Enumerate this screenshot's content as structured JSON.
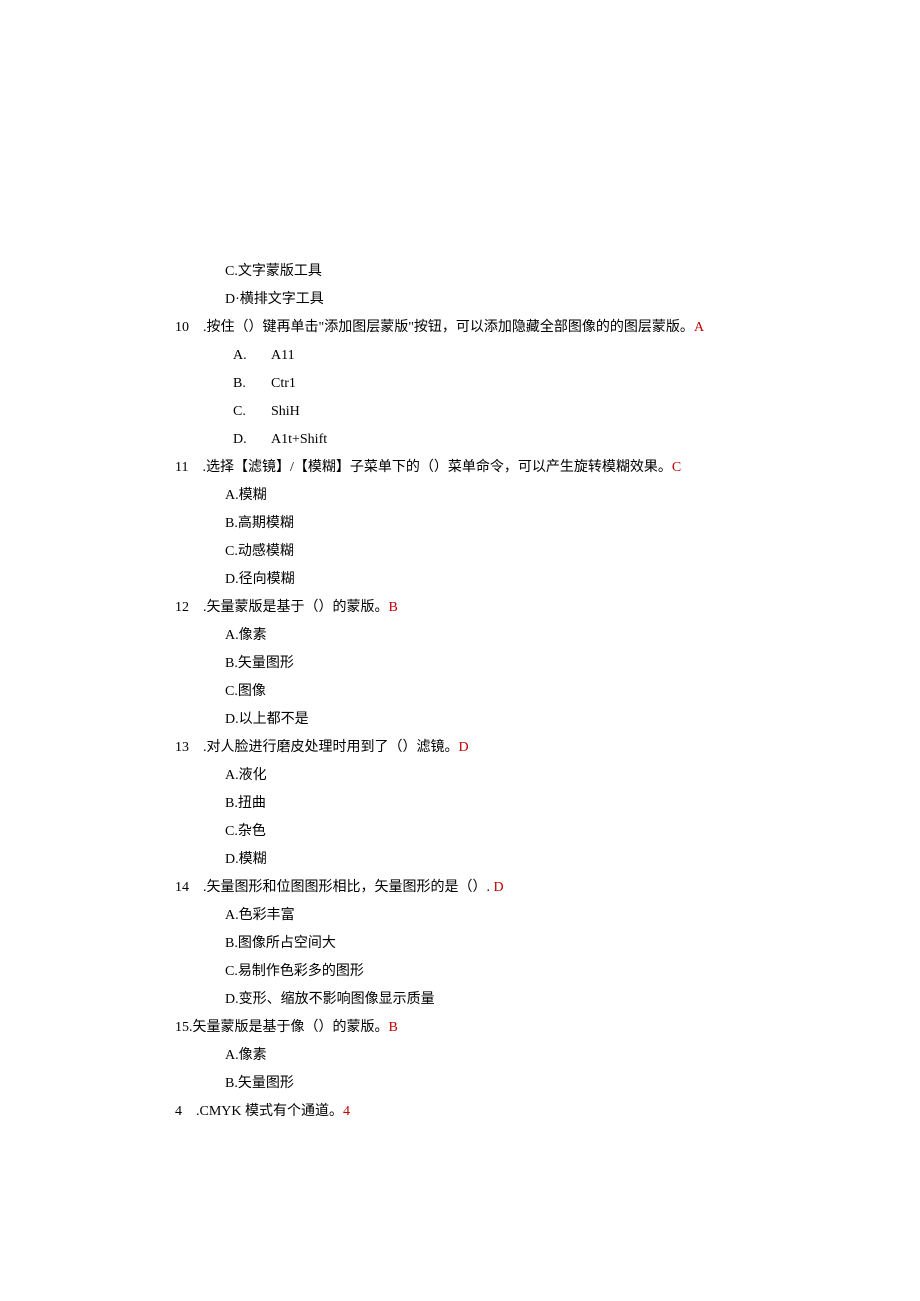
{
  "lines": [
    {
      "cls": "indent-2",
      "segments": [
        {
          "text": "C.文字蒙版工具"
        }
      ]
    },
    {
      "cls": "indent-2",
      "segments": [
        {
          "text": "D·横排文字工具"
        }
      ]
    },
    {
      "cls": "q-line",
      "segments": [
        {
          "text": "10　.按住（）键再单击\"添加图层蒙版\"按钮，可以添加隐藏全部图像的的图层蒙版。"
        },
        {
          "text": "A",
          "ans": true
        }
      ]
    },
    {
      "cls": "indent-3",
      "segments": [
        {
          "text": "A.",
          "letterWide": true
        },
        {
          "text": "A11"
        }
      ]
    },
    {
      "cls": "indent-3",
      "segments": [
        {
          "text": "B.",
          "letterWide": true
        },
        {
          "text": "Ctr1"
        }
      ]
    },
    {
      "cls": "indent-3",
      "segments": [
        {
          "text": "C.",
          "letterWide": true
        },
        {
          "text": "ShiH"
        }
      ]
    },
    {
      "cls": "indent-3",
      "segments": [
        {
          "text": "D.",
          "letterWide": true
        },
        {
          "text": "A1t+Shift"
        }
      ]
    },
    {
      "cls": "q-line",
      "segments": [
        {
          "text": "11　.选择【滤镜】/【模糊】子菜单下的（）菜单命令，可以产生旋转模糊效果。"
        },
        {
          "text": "C",
          "ans": true
        }
      ]
    },
    {
      "cls": "indent-2",
      "segments": [
        {
          "text": "A.模糊"
        }
      ]
    },
    {
      "cls": "indent-2",
      "segments": [
        {
          "text": "B.高期模糊"
        }
      ]
    },
    {
      "cls": "indent-2",
      "segments": [
        {
          "text": "C.动感模糊"
        }
      ]
    },
    {
      "cls": "indent-2",
      "segments": [
        {
          "text": "D.径向模糊"
        }
      ]
    },
    {
      "cls": "q-line",
      "segments": [
        {
          "text": "12　.矢量蒙版是基于（）的蒙版。"
        },
        {
          "text": "B",
          "ans": true
        }
      ]
    },
    {
      "cls": "indent-2",
      "segments": [
        {
          "text": "A.像素"
        }
      ]
    },
    {
      "cls": "indent-2",
      "segments": [
        {
          "text": "B.矢量图形"
        }
      ]
    },
    {
      "cls": "indent-2",
      "segments": [
        {
          "text": "C.图像"
        }
      ]
    },
    {
      "cls": "indent-2",
      "segments": [
        {
          "text": "D.以上都不是"
        }
      ]
    },
    {
      "cls": "q-line",
      "segments": [
        {
          "text": "13　.对人脸进行磨皮处理时用到了（）滤镜。"
        },
        {
          "text": "D",
          "ans": true
        }
      ]
    },
    {
      "cls": "indent-2",
      "segments": [
        {
          "text": "A.液化"
        }
      ]
    },
    {
      "cls": "indent-2",
      "segments": [
        {
          "text": "B.扭曲"
        }
      ]
    },
    {
      "cls": "indent-2",
      "segments": [
        {
          "text": "C.杂色"
        }
      ]
    },
    {
      "cls": "indent-2",
      "segments": [
        {
          "text": "D.模糊"
        }
      ]
    },
    {
      "cls": "q-line",
      "segments": [
        {
          "text": "14　.矢量图形和位图图形相比，矢量图形的是（）."
        },
        {
          "text": " D",
          "ans": true
        }
      ]
    },
    {
      "cls": "indent-2",
      "segments": [
        {
          "text": "A.色彩丰富"
        }
      ]
    },
    {
      "cls": "indent-2",
      "segments": [
        {
          "text": "B.图像所占空间大"
        }
      ]
    },
    {
      "cls": "indent-2",
      "segments": [
        {
          "text": "C.易制作色彩多的图形"
        }
      ]
    },
    {
      "cls": "indent-2",
      "segments": [
        {
          "text": "D.变形、缩放不影响图像显示质量"
        }
      ]
    },
    {
      "cls": "q-line",
      "segments": [
        {
          "text": "15.矢量蒙版是基于像（）的蒙版。"
        },
        {
          "text": "B",
          "ans": true
        }
      ]
    },
    {
      "cls": "indent-2",
      "segments": [
        {
          "text": "A.像素"
        }
      ]
    },
    {
      "cls": "indent-2",
      "segments": [
        {
          "text": "B.矢量图形"
        }
      ]
    },
    {
      "cls": "q-line",
      "segments": [
        {
          "text": "4　.CMYK 模式有个通道。"
        },
        {
          "text": "4",
          "ans": true
        }
      ]
    }
  ]
}
